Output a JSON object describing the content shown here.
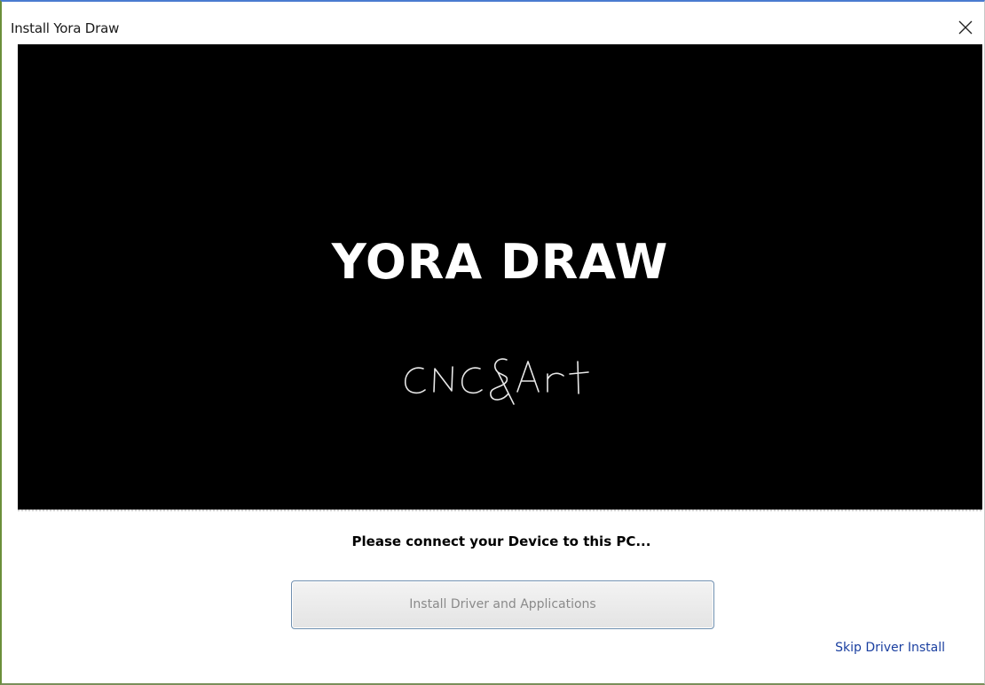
{
  "window": {
    "title": "Install Yora Draw",
    "close_icon": "close-icon"
  },
  "banner": {
    "title": "YORA DRAW",
    "subtitle": "CNC&Art",
    "background": "#000000",
    "text_color": "#ffffff"
  },
  "main": {
    "message": "Please connect your Device to this PC...",
    "install_button_label": "Install Driver and Applications",
    "skip_link_label": "Skip Driver Install",
    "link_color": "#1a3fa0"
  }
}
